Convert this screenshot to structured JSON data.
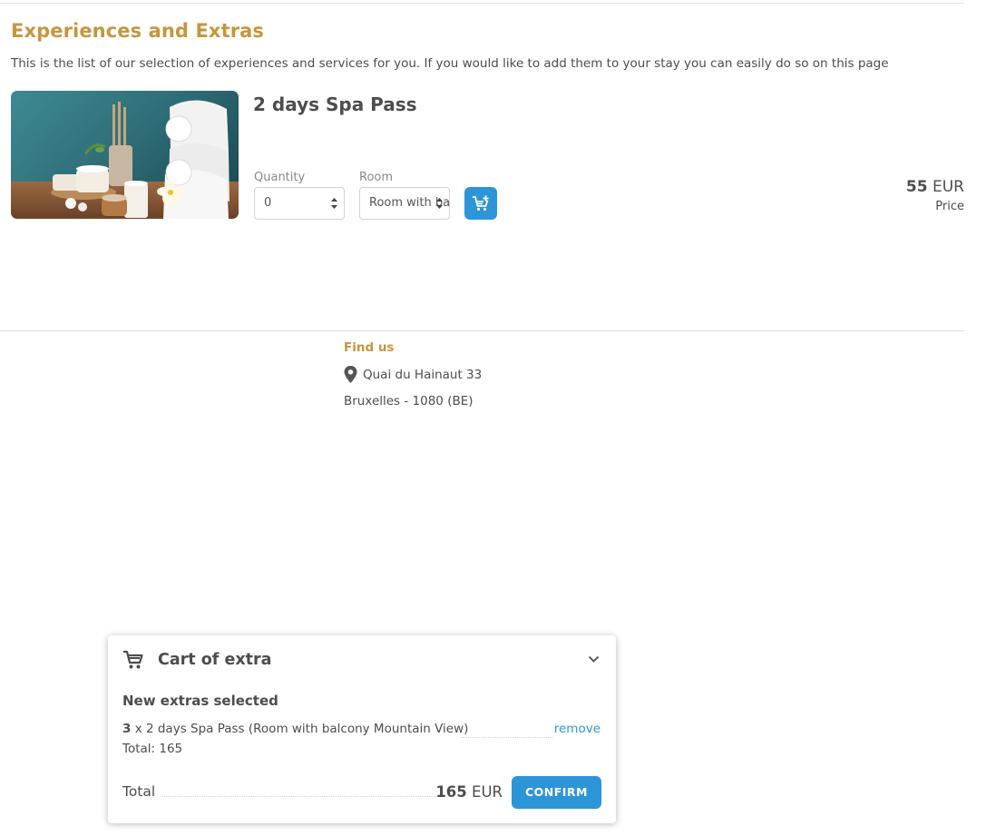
{
  "header": {
    "title": "Experiences and Extras",
    "intro": "This is the list of our selection of experiences and services for you. If you would like to add them to your stay you can easily do so on this page"
  },
  "product": {
    "name": "2 days Spa Pass",
    "image_alt": "spa-towels-candles-image",
    "quantity_label": "Quantity",
    "quantity_value": "0",
    "room_label": "Room",
    "room_value": "Room with balcony Mountain View",
    "add_icon": "cart-plus-icon",
    "price_amount": "55",
    "price_currency": "EUR",
    "price_caption": "Price"
  },
  "footer": {
    "find_us_title": "Find us",
    "address_icon": "map-pin-icon",
    "address_line1": "Quai du Hainaut 33",
    "address_line2": "Bruxelles - 1080 (BE)"
  },
  "cart": {
    "icon": "cart-icon",
    "title": "Cart of extra",
    "chevron_icon": "chevron-down-icon",
    "section_title": "New extras selected",
    "items": [
      {
        "qty": "3",
        "description": " x 2 days Spa Pass (Room with balcony Mountain View)",
        "remove_label": "remove",
        "total": "Total: 165"
      }
    ],
    "total_label": "Total",
    "total_amount": "165",
    "total_currency": "EUR",
    "confirm_label": "CONFIRM"
  },
  "colors": {
    "accent_gold": "#c6963d",
    "primary_blue": "#2c95d8",
    "text": "#4d4d4d"
  }
}
